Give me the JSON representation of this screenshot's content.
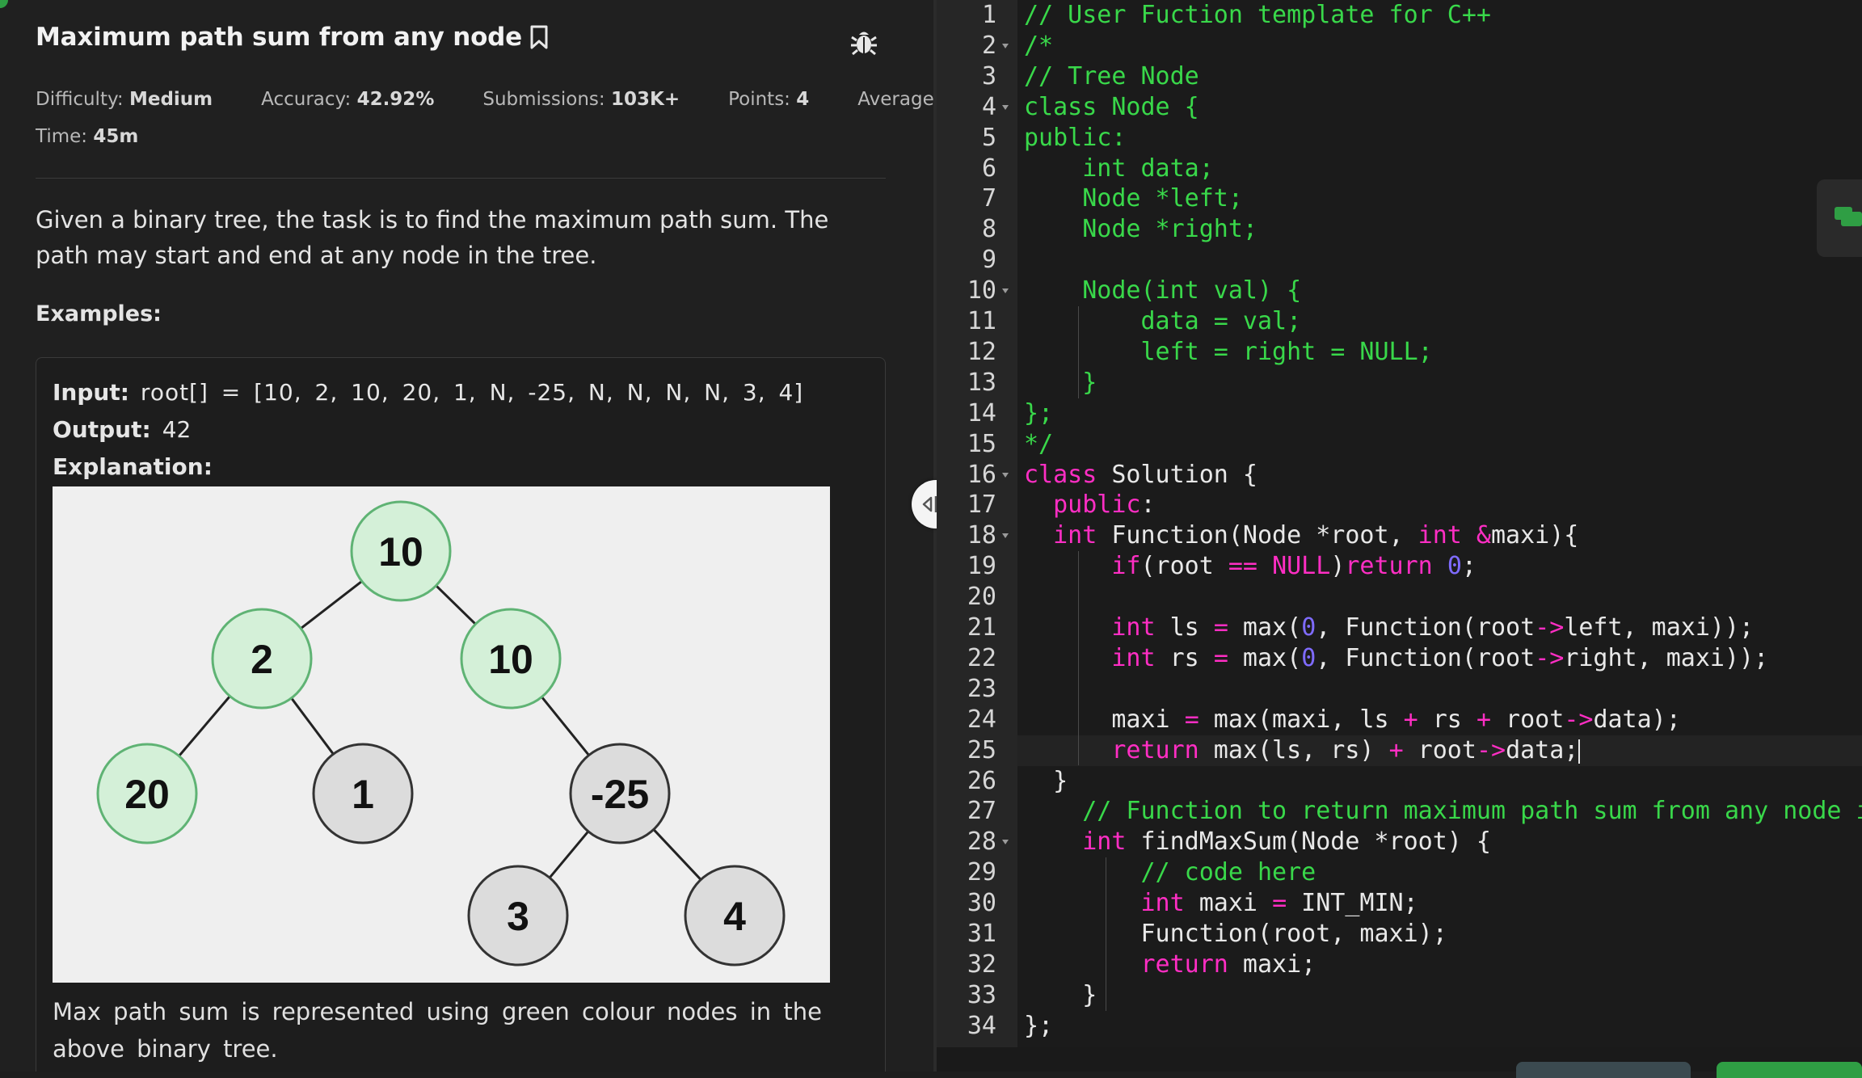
{
  "problem": {
    "title": "Maximum path sum from any node",
    "meta": {
      "difficulty_label": "Difficulty:",
      "difficulty": "Medium",
      "accuracy_label": "Accuracy:",
      "accuracy": "42.92%",
      "submissions_label": "Submissions:",
      "submissions": "103K+",
      "points_label": "Points:",
      "points": "4",
      "average": "Average",
      "time_label": "Time:",
      "time": "45m"
    },
    "description": "Given a binary tree, the task is to find the maximum path sum. The path may start and end at any node in the tree.",
    "examples_heading": "Examples:",
    "example": {
      "input_label": "Input:",
      "input_value": "root[] = [10, 2, 10, 20, 1, N, -25, N, N, N, N, 3, 4]",
      "output_label": "Output:",
      "output_value": "42",
      "explanation_label": "Explanation:",
      "caption": "Max path sum is represented using green colour nodes in the above binary tree.",
      "tree_nodes": [
        {
          "label": "10",
          "highlight": true
        },
        {
          "label": "2",
          "highlight": true
        },
        {
          "label": "10",
          "highlight": true
        },
        {
          "label": "20",
          "highlight": true
        },
        {
          "label": "1",
          "highlight": false
        },
        {
          "label": "-25",
          "highlight": false
        },
        {
          "label": "3",
          "highlight": false
        },
        {
          "label": "4",
          "highlight": false
        }
      ]
    }
  },
  "icons": {
    "bookmark": "bookmark-icon",
    "bug": "bug-icon",
    "splitter": "split-handle-icon"
  },
  "colors": {
    "keyword": "#ff2ec4",
    "comment": "#39d84a",
    "number": "#7f6bff",
    "highlight_node": "#d4f0d8",
    "plain_node": "#dcdcdc"
  },
  "editor": {
    "active_line": 25,
    "lines": [
      {
        "n": "1",
        "text": "// User Fuction template for C++"
      },
      {
        "n": "2",
        "text": "/*"
      },
      {
        "n": "3",
        "text": "// Tree Node"
      },
      {
        "n": "4",
        "text": "class Node {"
      },
      {
        "n": "5",
        "text": "public:"
      },
      {
        "n": "6",
        "text": "    int data;"
      },
      {
        "n": "7",
        "text": "    Node *left;"
      },
      {
        "n": "8",
        "text": "    Node *right;"
      },
      {
        "n": "9",
        "text": ""
      },
      {
        "n": "10",
        "text": "    Node(int val) {"
      },
      {
        "n": "11",
        "text": "        data = val;"
      },
      {
        "n": "12",
        "text": "        left = right = NULL;"
      },
      {
        "n": "13",
        "text": "    }"
      },
      {
        "n": "14",
        "text": "};"
      },
      {
        "n": "15",
        "text": "*/"
      },
      {
        "n": "16",
        "text": "class Solution {"
      },
      {
        "n": "17",
        "text": "  public:"
      },
      {
        "n": "18",
        "text": "  int Function(Node *root, int &maxi){"
      },
      {
        "n": "19",
        "text": "      if(root == NULL)return 0;"
      },
      {
        "n": "20",
        "text": ""
      },
      {
        "n": "21",
        "text": "      int ls = max(0, Function(root->left, maxi));"
      },
      {
        "n": "22",
        "text": "      int rs = max(0, Function(root->right, maxi));"
      },
      {
        "n": "23",
        "text": ""
      },
      {
        "n": "24",
        "text": "      maxi = max(maxi, ls + rs + root->data);"
      },
      {
        "n": "25",
        "text": "      return max(ls, rs) + root->data;"
      },
      {
        "n": "26",
        "text": "  }"
      },
      {
        "n": "27",
        "text": "    // Function to return maximum path sum from any node in a"
      },
      {
        "n": "28",
        "text": "    int findMaxSum(Node *root) {"
      },
      {
        "n": "29",
        "text": "        // code here"
      },
      {
        "n": "30",
        "text": "        int maxi = INT_MIN;"
      },
      {
        "n": "31",
        "text": "        Function(root, maxi);"
      },
      {
        "n": "32",
        "text": "        return maxi;"
      },
      {
        "n": "33",
        "text": "    }"
      },
      {
        "n": "34",
        "text": "};"
      }
    ]
  }
}
